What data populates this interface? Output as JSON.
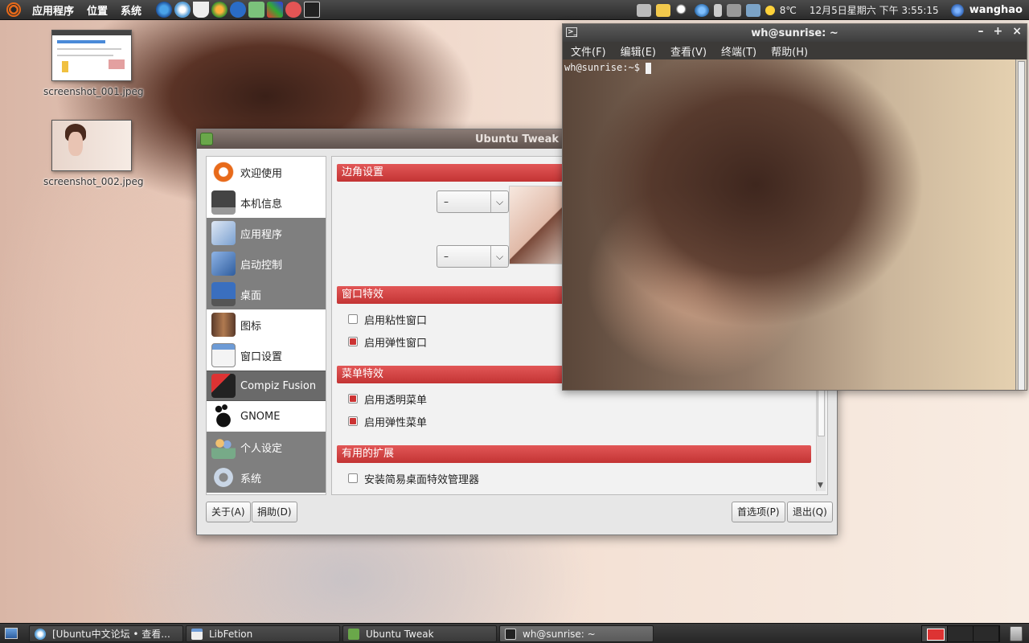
{
  "top_panel": {
    "menus": [
      "应用程序",
      "位置",
      "系统"
    ],
    "temperature": "8℃",
    "datetime": "12月5日星期六 下午 3:55:15",
    "user": "wanghao"
  },
  "desktop_icons": [
    {
      "label": "screenshot_001.jpeg"
    },
    {
      "label": "screenshot_002.jpeg"
    }
  ],
  "tweak": {
    "title": "Ubuntu Tweak",
    "sidebar": [
      {
        "label": "欢迎使用",
        "icon": "ubuntu-logo-icon"
      },
      {
        "label": "本机信息",
        "icon": "computer-icon"
      },
      {
        "label": "应用程序",
        "icon": "applications-icon"
      },
      {
        "label": "启动控制",
        "icon": "startup-icon"
      },
      {
        "label": "桌面",
        "icon": "desktop-icon"
      },
      {
        "label": "图标",
        "icon": "icons-icon"
      },
      {
        "label": "窗口设置",
        "icon": "window-icon"
      },
      {
        "label": "Compiz Fusion",
        "icon": "compiz-icon"
      },
      {
        "label": "GNOME",
        "icon": "gnome-foot-icon"
      },
      {
        "label": "个人设定",
        "icon": "personal-icon"
      },
      {
        "label": "系统",
        "icon": "system-gear-icon"
      }
    ],
    "sections": {
      "corner": "边角设置",
      "window_effects": "窗口特效",
      "menu_effects": "菜单特效",
      "extensions": "有用的扩展"
    },
    "combos": [
      "–",
      "–"
    ],
    "checks": {
      "sticky": {
        "label": "启用粘性窗口",
        "checked": false
      },
      "wobbly": {
        "label": "启用弹性窗口",
        "checked": true
      },
      "transparent_menu": {
        "label": "启用透明菜单",
        "checked": true
      },
      "wobbly_menu": {
        "label": "启用弹性菜单",
        "checked": true
      },
      "simple_ccsm": {
        "label": "安装简易桌面特效管理器",
        "checked": false
      }
    },
    "buttons": {
      "about": "关于(A)",
      "donate": "捐助(D)",
      "prefs": "首选项(P)",
      "quit": "退出(Q)"
    }
  },
  "terminal": {
    "title": "wh@sunrise: ~",
    "menu": [
      "文件(F)",
      "编辑(E)",
      "查看(V)",
      "终端(T)",
      "帮助(H)"
    ],
    "prompt": "wh@sunrise:~$ "
  },
  "taskbar": [
    {
      "label": "[Ubuntu中文论坛 • 查看...",
      "icon": "browser-icon"
    },
    {
      "label": "LibFetion",
      "icon": "window-icon"
    },
    {
      "label": "Ubuntu Tweak",
      "icon": "tweak-icon"
    },
    {
      "label": "wh@sunrise: ~",
      "icon": "terminal-icon"
    }
  ],
  "colors": {
    "accent_red": "#c33434",
    "panel_dark": "#2b2b2b"
  }
}
